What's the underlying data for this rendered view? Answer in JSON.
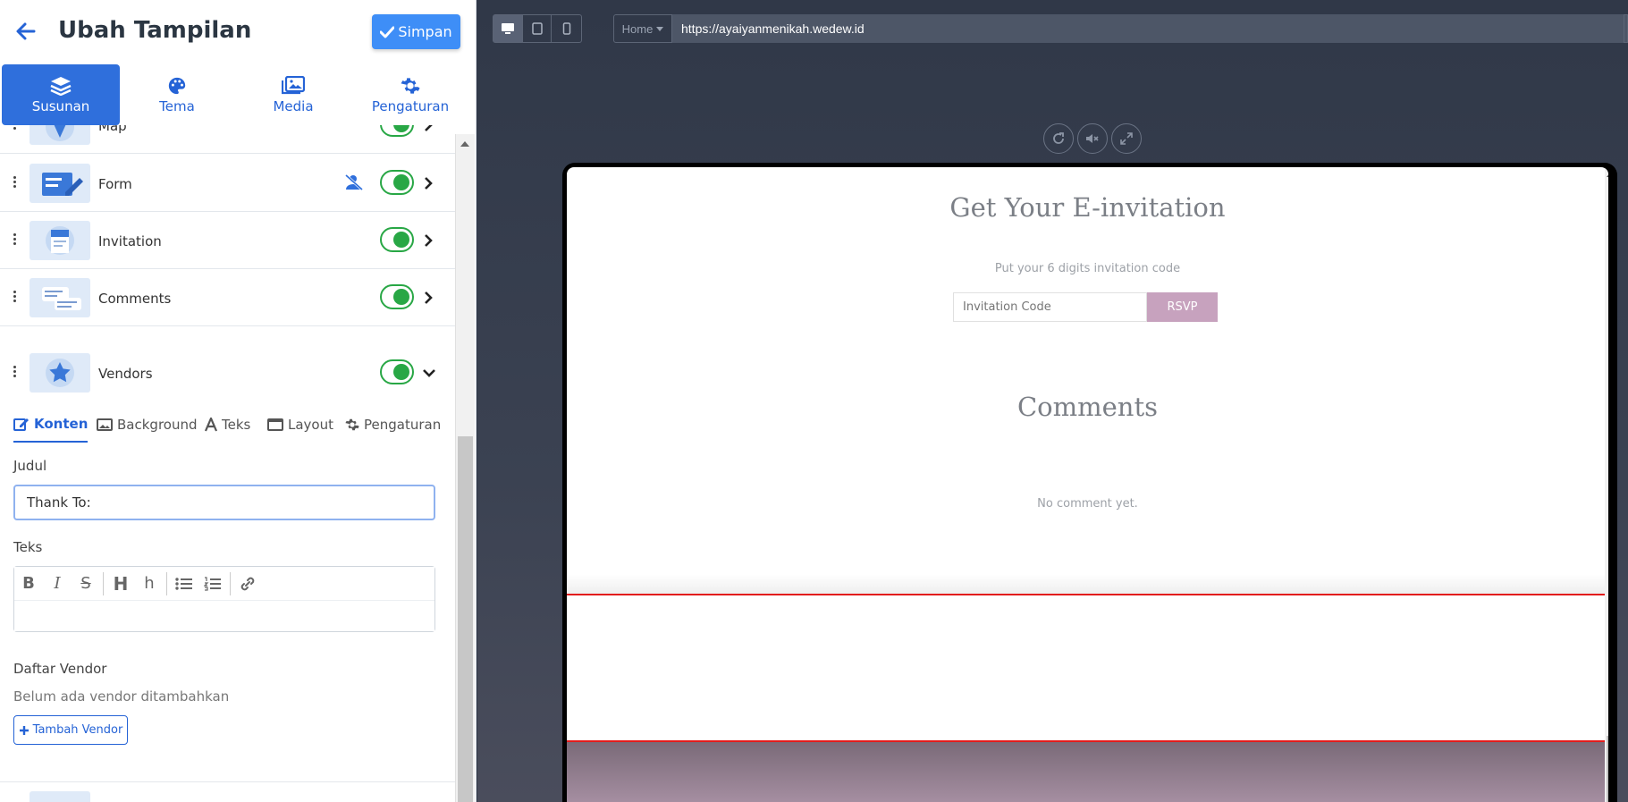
{
  "editor": {
    "title": "Ubah Tampilan",
    "save_label": "Simpan",
    "tabs": [
      {
        "label": "Susunan",
        "icon": "layers-icon",
        "active": true
      },
      {
        "label": "Tema",
        "icon": "palette-icon",
        "active": false
      },
      {
        "label": "Media",
        "icon": "images-icon",
        "active": false
      },
      {
        "label": "Pengaturan",
        "icon": "gear-icon",
        "active": false
      }
    ],
    "sections": [
      {
        "label": "Map",
        "enabled": true
      },
      {
        "label": "Form",
        "enabled": true,
        "hidden_guest": true
      },
      {
        "label": "Invitation",
        "enabled": true
      },
      {
        "label": "Comments",
        "enabled": true
      },
      {
        "label": "Vendors",
        "enabled": true,
        "expanded": true
      }
    ],
    "vendor_panel": {
      "subtabs": [
        {
          "label": "Konten",
          "icon": "edit-icon",
          "active": true
        },
        {
          "label": "Background",
          "icon": "image-icon",
          "active": false
        },
        {
          "label": "Teks",
          "icon": "font-icon",
          "active": false
        },
        {
          "label": "Layout",
          "icon": "window-icon",
          "active": false
        },
        {
          "label": "Pengaturan",
          "icon": "gear-icon",
          "active": false
        }
      ],
      "judul_label": "Judul",
      "judul_value": "Thank To:",
      "teks_label": "Teks",
      "daftar_label": "Daftar Vendor",
      "empty_text": "Belum ada vendor ditambahkan",
      "add_label": "Tambah Vendor"
    }
  },
  "preview": {
    "page_select": "Home",
    "url": "https://ayaiyanmenikah.wedew.id",
    "invitation": {
      "title": "Get Your E-invitation",
      "subtitle": "Put your 6 digits invitation code",
      "input_placeholder": "Invitation Code",
      "button_label": "RSVP"
    },
    "comments": {
      "title": "Comments",
      "empty_text": "No comment yet."
    }
  },
  "colors": {
    "primary": "#2f6fdc",
    "save_button": "#3e8ef7",
    "toggle_on": "#28a745",
    "rsvp": "#c7a2be",
    "highlight": "#e21c1c"
  }
}
